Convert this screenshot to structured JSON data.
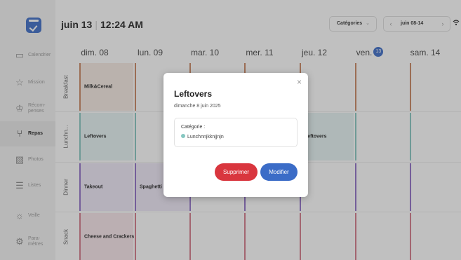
{
  "header": {
    "date": "juin 13",
    "time": "12:24 AM",
    "categories_label": "Catégories",
    "week_label": "juin 08-14"
  },
  "sidebar": {
    "items": [
      {
        "label": "Calendrier",
        "icon": "calendar-icon"
      },
      {
        "label": "Mission",
        "icon": "star-icon"
      },
      {
        "label": "Récom-penses",
        "icon": "crown-icon"
      },
      {
        "label": "Repas",
        "icon": "utensils-icon",
        "active": true
      },
      {
        "label": "Photos",
        "icon": "image-icon"
      },
      {
        "label": "Listes",
        "icon": "list-icon"
      },
      {
        "label": "Veille",
        "icon": "sun-icon"
      },
      {
        "label": "Para-mètres",
        "icon": "gear-icon"
      }
    ]
  },
  "days": [
    "dim. 08",
    "lun. 09",
    "mar. 10",
    "mer. 11",
    "jeu. 12",
    "ven.",
    "sam. 14"
  ],
  "today_badge": "13",
  "rows": [
    {
      "label": "Breakfast",
      "color": "#c98561",
      "bg": "#f7ebe4",
      "cells": [
        "Milk&Cereal",
        "",
        "",
        "",
        "",
        "",
        ""
      ]
    },
    {
      "label": "Lunchn...",
      "color": "#86c7c1",
      "bg": "#e6f4f3",
      "cells": [
        "Leftovers",
        "",
        "",
        "",
        "Leftovers",
        "",
        ""
      ]
    },
    {
      "label": "Dinner",
      "color": "#8f6fc8",
      "bg": "#efe9f8",
      "cells": [
        "Takeout",
        "Spaghetti",
        "",
        "",
        "",
        "",
        ""
      ]
    },
    {
      "label": "Snack",
      "color": "#d47a8a",
      "bg": "#f8e6ea",
      "cells": [
        "Cheese and Crackers",
        "",
        "",
        "",
        "",
        "",
        ""
      ]
    }
  ],
  "modal": {
    "title": "Leftovers",
    "date": "dimanche 8 juin 2025",
    "category_label": "Catégorie :",
    "category_value": "Lunchnnjkknjjnjn",
    "delete_label": "Supprimer",
    "edit_label": "Modifier",
    "close_icon": "×"
  }
}
